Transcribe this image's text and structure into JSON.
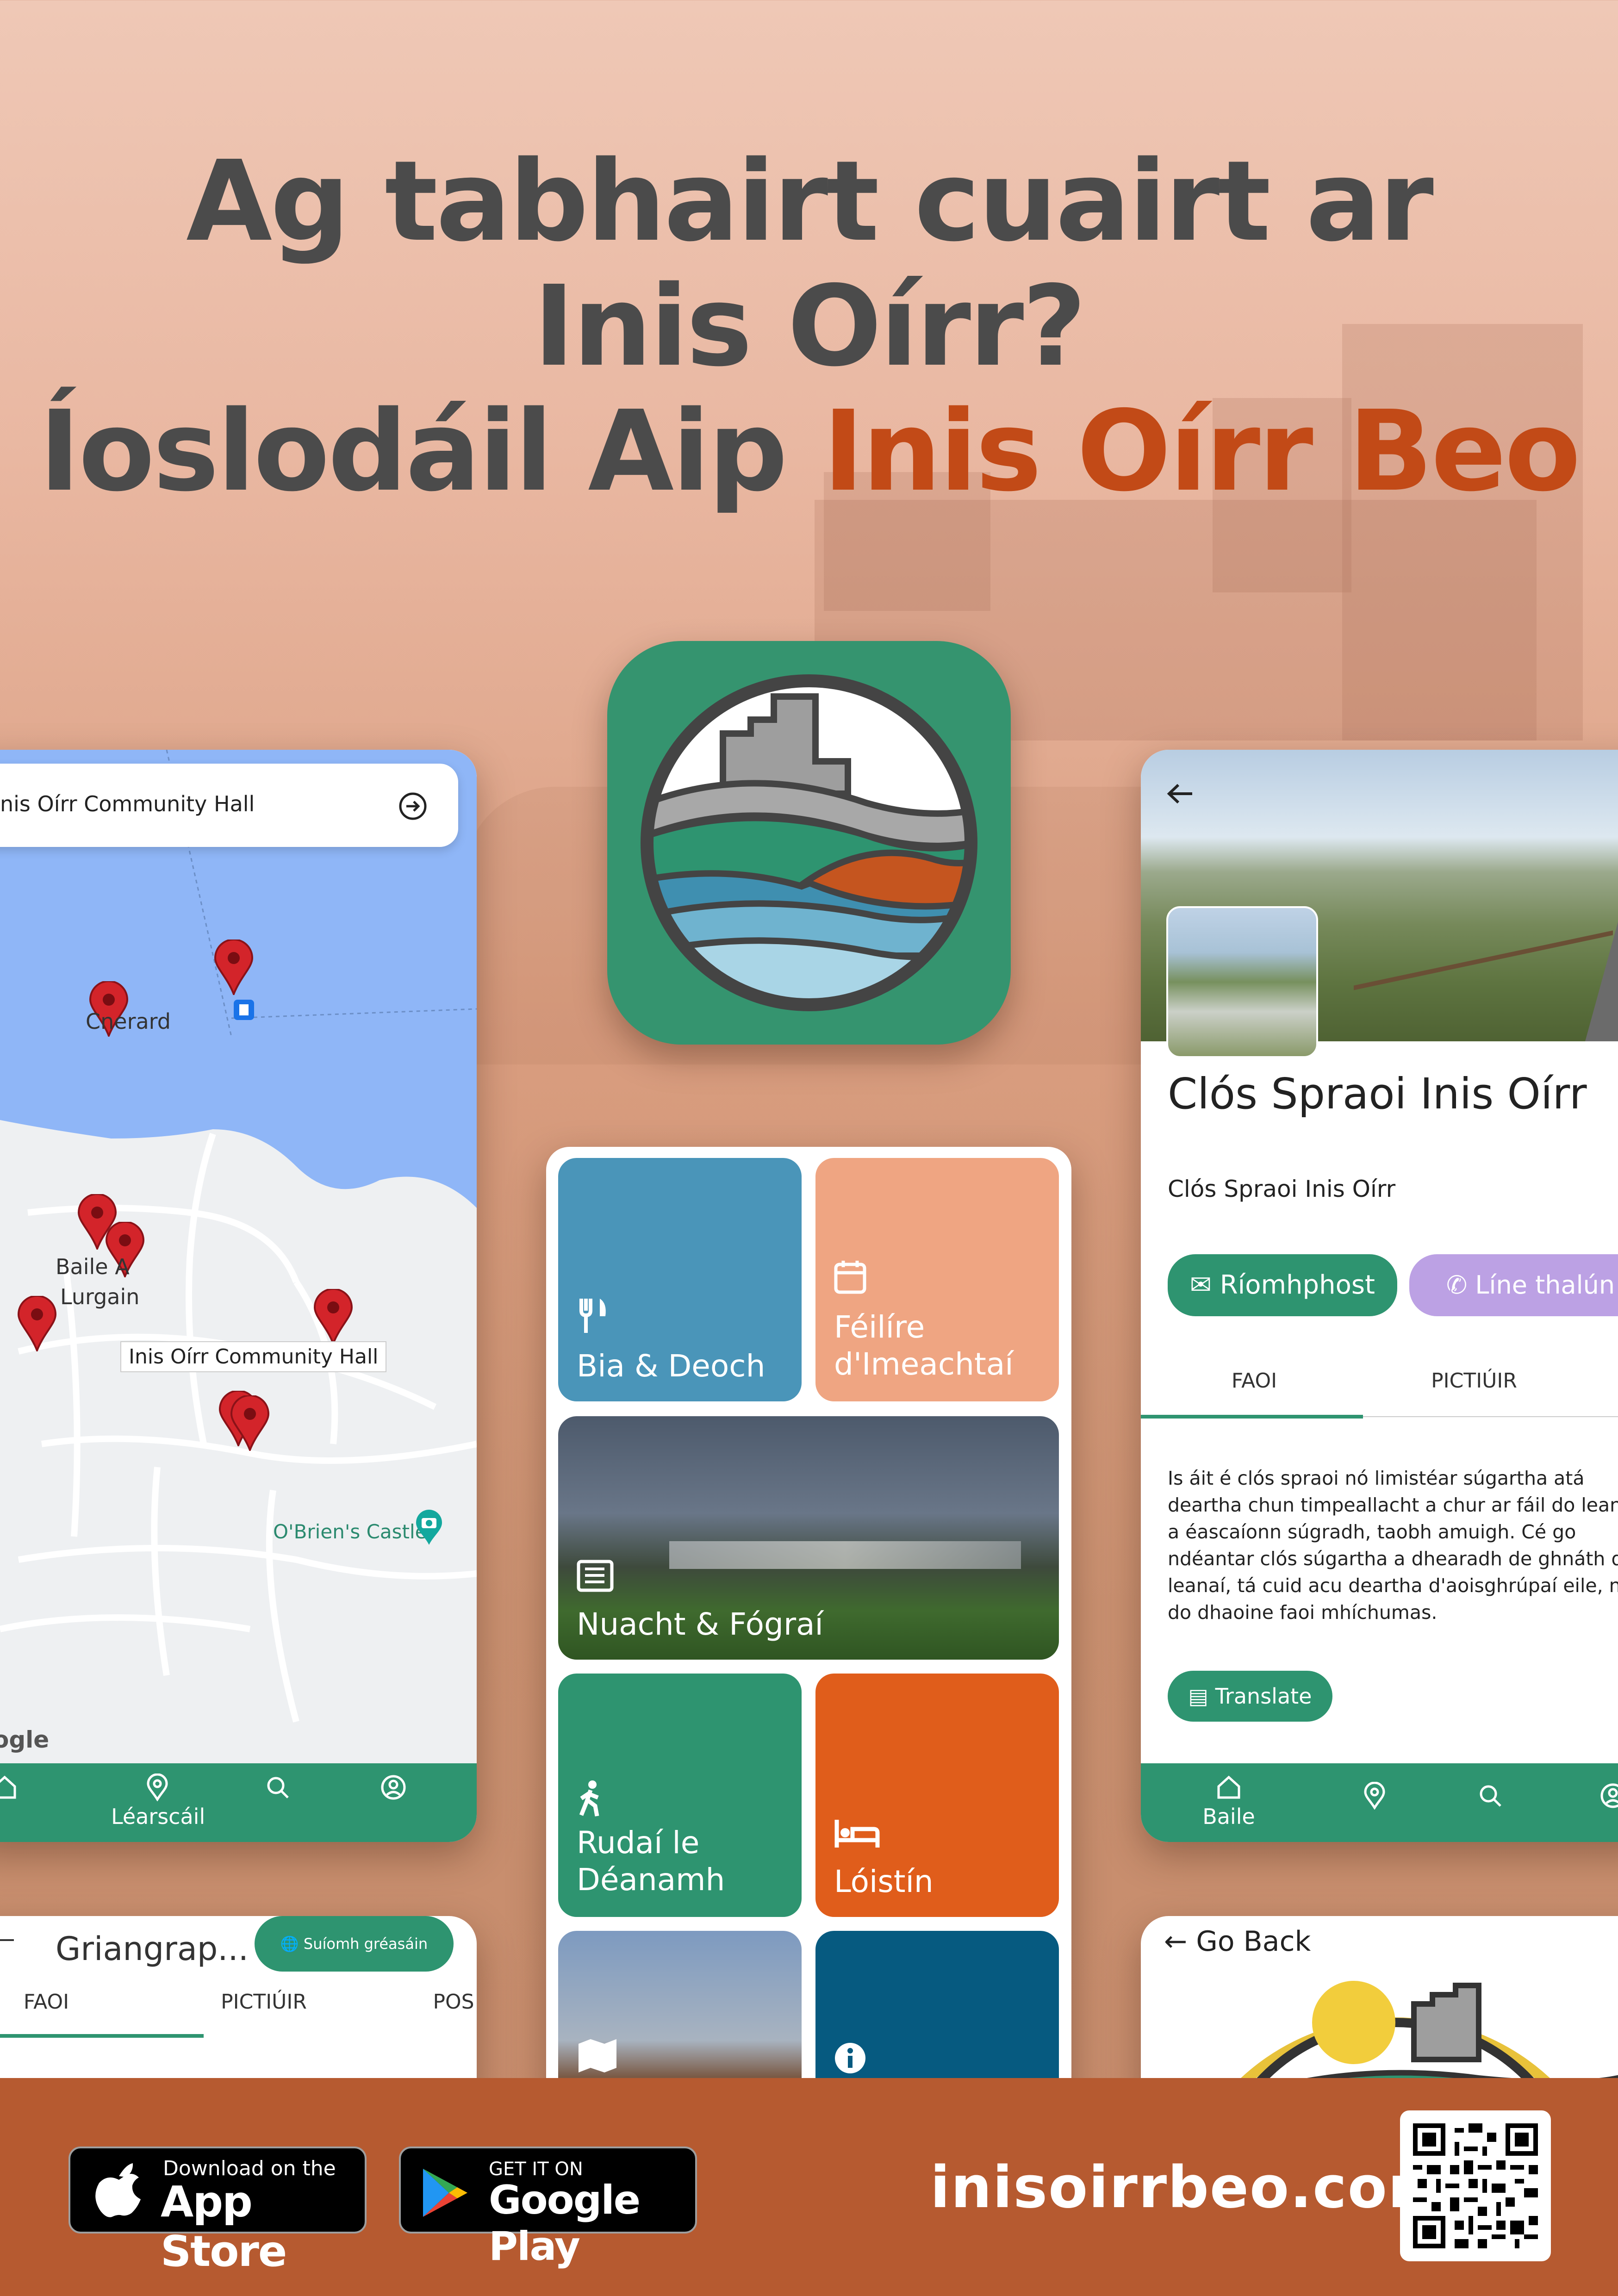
{
  "headline": {
    "line1": "Ag tabhairt cuairt ar",
    "line2": "Inis Oírr?",
    "line3_prefix": "Íoslodáil  Aip ",
    "line3_accent": "Inis Oírr Beo"
  },
  "colors": {
    "brand_green": "#2e9470",
    "accent_orange": "#c24a17",
    "footer": "#b65a30",
    "map_water": "#8fb6f7",
    "pin_red": "#d3242a"
  },
  "map_screen": {
    "search_value": "nis Oírr Community Hall",
    "labels": {
      "cnerard": "Cnerard",
      "baile": "Baile A",
      "lurgain": "Lurgain",
      "callout": "Inis Oírr Community Hall",
      "castle": "O'Brien's Castle",
      "google": "ogle"
    },
    "nav": {
      "lеarscail_label": "Léarscáil"
    }
  },
  "bottom_left_screen": {
    "title": "Griangrap...",
    "button": "Suíomh gréasáin",
    "tabs": [
      "FAOI",
      "PICTIÚIR",
      "POS"
    ]
  },
  "home_screen": {
    "tiles": {
      "bia": "Bia & Deoch",
      "feilire_1": "Féilíre",
      "feilire_2": "d'Imeachtaí",
      "nuacht": "Nuacht & Fógraí",
      "rudai_1": "Rudaí le",
      "rudai_2": "Déanamh",
      "loistin": "Lóistín"
    }
  },
  "detail_screen": {
    "title": "Clós Spraoi Inis Oírr",
    "subtitle": "Clós Spraoi Inis Oírr",
    "email_button": "Ríomhphost",
    "phone_button": "Líne thalún",
    "tabs": [
      "FAOI",
      "PICTIÚIR"
    ],
    "description": "Is áit é clós spraoi nó limistéar súgartha atá deartha chun timpeallacht a chur ar fáil do leanaí a éascaíonn súgradh, taobh amuigh. Cé go ndéantar clós súgartha a dhearadh de ghnáth do leanaí, tá cuid acu deartha d'aoisghrúpaí eile, nó do dhaoine faoi mhíchumas.",
    "translate_button": "Translate",
    "nav_home_label": "Baile"
  },
  "go_back_screen": {
    "go_back": "Go Back"
  },
  "footer": {
    "appstore_small": "Download on the",
    "appstore_big": "App Store",
    "gplay_small": "GET IT ON",
    "gplay_big": "Google Play",
    "website": "inisoirrbeo.com"
  },
  "icons": [
    "app-logo-icon",
    "location-pin-icon",
    "home-icon",
    "search-icon",
    "profile-icon",
    "arrow-right-circle-icon",
    "back-arrow-icon",
    "fork-knife-icon",
    "calendar-icon",
    "newspaper-icon",
    "walking-icon",
    "bed-icon",
    "map-icon",
    "info-icon",
    "globe-icon",
    "mail-icon",
    "phone-icon",
    "translate-icon",
    "camera-icon",
    "apple-icon",
    "google-play-icon",
    "qr-code-icon"
  ]
}
